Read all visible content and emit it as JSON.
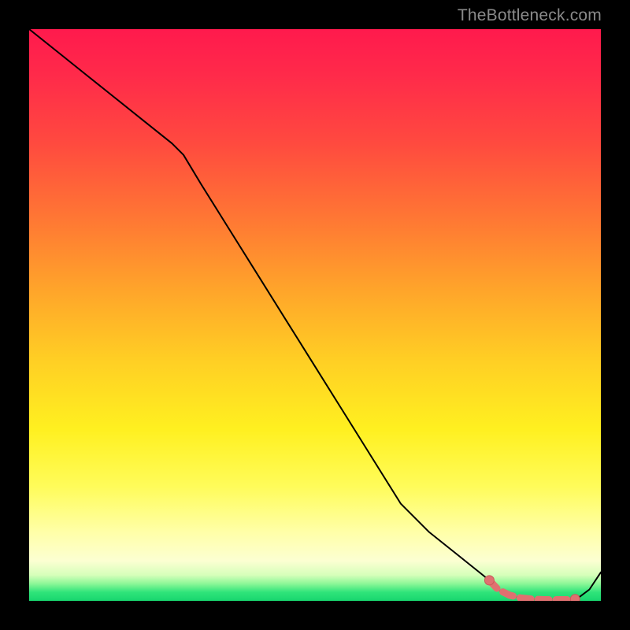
{
  "watermark": {
    "text": "TheBottleneck.com"
  },
  "colors": {
    "line": "#000000",
    "marker_fill": "#e07070",
    "marker_stroke": "#c85a5a"
  },
  "chart_data": {
    "type": "line",
    "title": "",
    "xlabel": "",
    "ylabel": "",
    "xlim": [
      0,
      100
    ],
    "ylim": [
      0,
      100
    ],
    "grid": false,
    "series": [
      {
        "name": "curve",
        "x": [
          0,
          5,
          10,
          15,
          20,
          25,
          27,
          30,
          35,
          40,
          45,
          50,
          55,
          60,
          65,
          70,
          75,
          80,
          82,
          84,
          86,
          88,
          90,
          92,
          94,
          96,
          98,
          100
        ],
        "y": [
          100,
          96,
          92,
          88,
          84,
          80,
          78,
          73,
          65,
          57,
          49,
          41,
          33,
          25,
          17,
          12,
          8,
          4,
          2,
          1,
          0.5,
          0.3,
          0.2,
          0.2,
          0.2,
          0.5,
          2,
          5
        ]
      }
    ],
    "markers": {
      "name": "highlighted-segment",
      "x": [
        80.5,
        82,
        84,
        86,
        88,
        90,
        92,
        94,
        95.5
      ],
      "y": [
        3.6,
        2.0,
        1.0,
        0.5,
        0.3,
        0.2,
        0.2,
        0.2,
        0.3
      ]
    }
  }
}
